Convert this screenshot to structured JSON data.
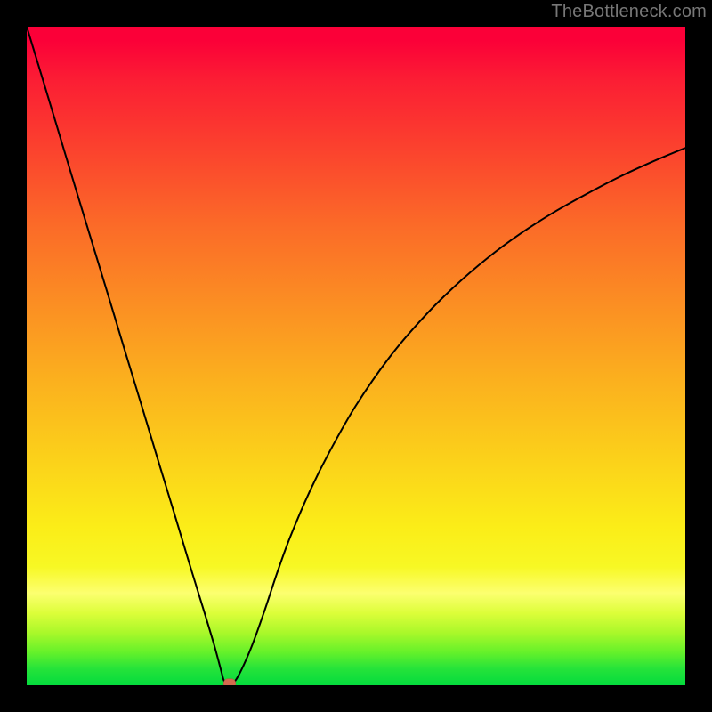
{
  "attribution": "TheBottleneck.com",
  "colors": {
    "frame": "#000000",
    "curve": "#000000",
    "marker": "#d36a4e",
    "gradient_top": "#fb0038",
    "gradient_bottom": "#04db3d"
  },
  "chart_data": {
    "type": "line",
    "title": "",
    "xlabel": "",
    "ylabel": "",
    "xlim": [
      0,
      100
    ],
    "ylim": [
      0,
      100
    ],
    "grid": false,
    "legend": false,
    "annotations": [],
    "series": [
      {
        "name": "curve",
        "x": [
          0,
          2.5,
          5,
          7.5,
          10,
          12.5,
          15,
          17.5,
          20,
          22.5,
          25,
          27,
          28.5,
          29.5,
          30,
          30.8,
          32,
          34,
          36,
          38,
          40,
          43,
          46,
          50,
          55,
          60,
          65,
          70,
          75,
          80,
          85,
          90,
          95,
          100
        ],
        "values": [
          100,
          91.8,
          83.5,
          75.2,
          67,
          58.8,
          50.5,
          42.3,
          34,
          25.8,
          17.5,
          11,
          6,
          2.3,
          0.6,
          0,
          1.2,
          5.5,
          11,
          17,
          22.5,
          29.5,
          35.5,
          42.5,
          49.7,
          55.6,
          60.6,
          64.9,
          68.6,
          71.8,
          74.6,
          77.2,
          79.5,
          81.6
        ]
      }
    ],
    "marker": {
      "x": 30.8,
      "y": 0.3,
      "color": "#d36a4e"
    }
  }
}
